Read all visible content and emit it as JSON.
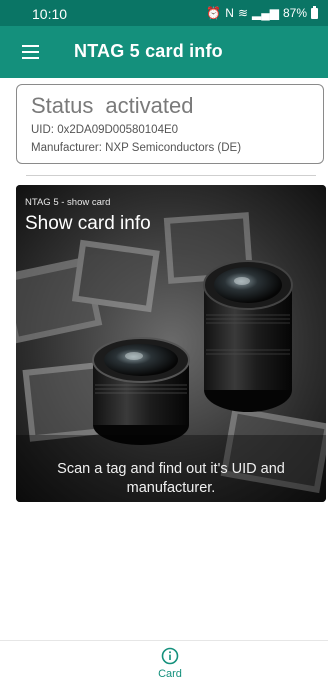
{
  "status_bar": {
    "time": "10:10",
    "battery": "87%"
  },
  "app_bar": {
    "title": "NTAG 5 card info"
  },
  "status_card": {
    "label": "Status",
    "value": "activated",
    "uid": "UID:  0x2DA09D00580104E0",
    "manufacturer": "Manufacturer:  NXP Semiconductors (DE)"
  },
  "feature_card": {
    "subtitle": "NTAG 5 - show card",
    "title": "Show card info",
    "description": "Scan a tag and find out it's UID and manufacturer.",
    "image": "camera-lens-photos-image"
  },
  "bottom_nav": {
    "items": [
      {
        "label": "Card",
        "icon": "info-icon"
      }
    ]
  },
  "colors": {
    "status_bar": "#0a7565",
    "app_bar": "#14907c",
    "accent": "#14907c"
  }
}
